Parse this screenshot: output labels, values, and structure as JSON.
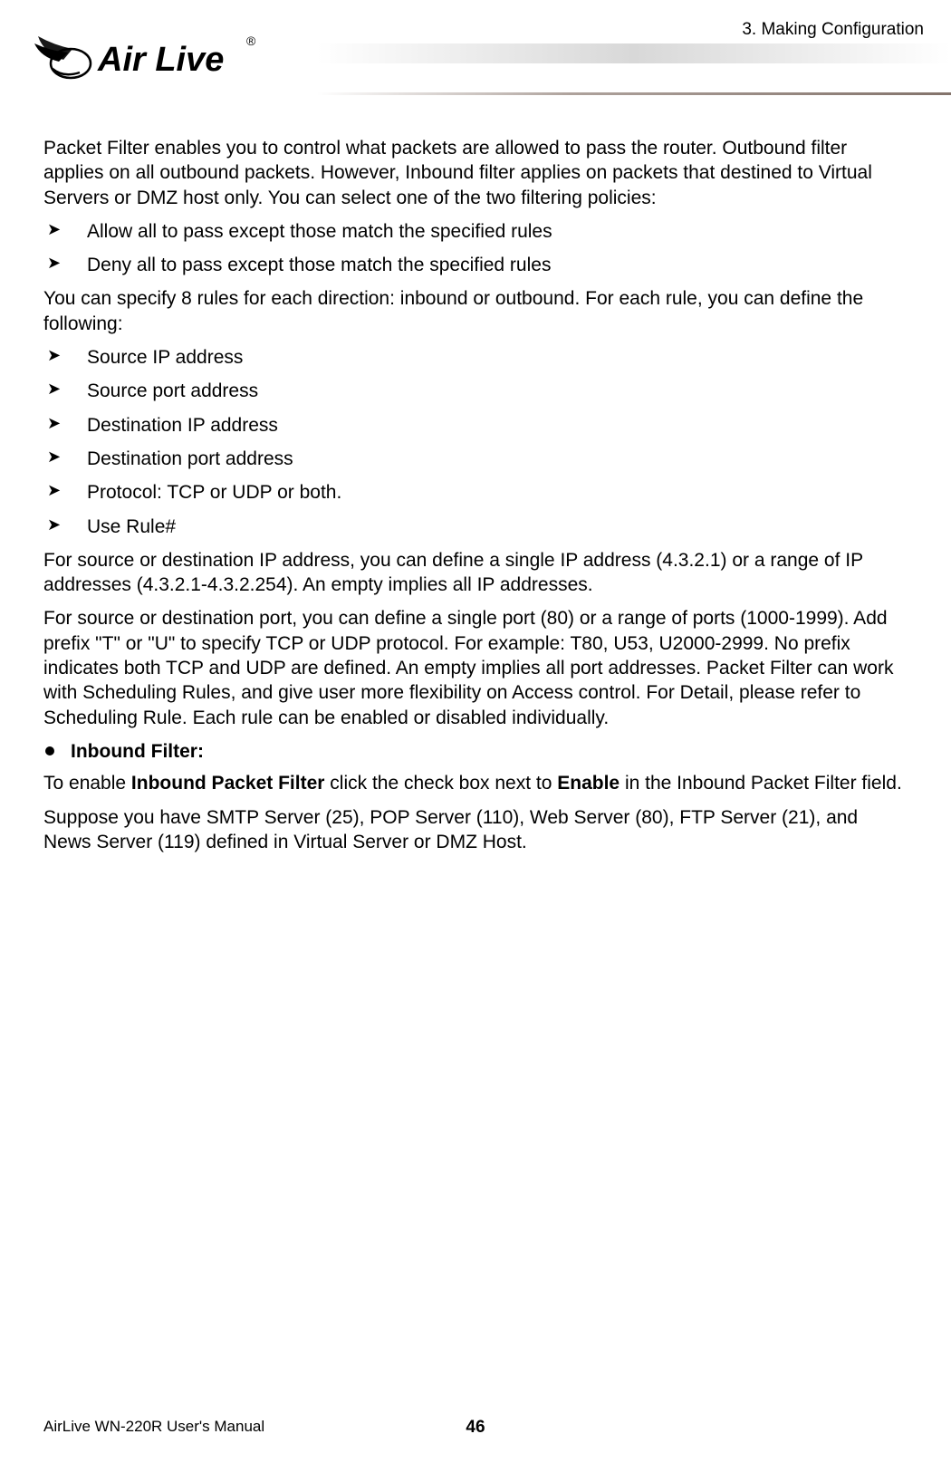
{
  "header": {
    "section_label": "3. Making Configuration",
    "logo_text": "Air Live",
    "trademark": "®"
  },
  "content": {
    "intro_para": "Packet Filter enables you to control what packets are allowed to pass the router. Outbound filter applies on all outbound packets. However, Inbound filter applies on packets that destined to Virtual Servers or DMZ host only. You can select one of the two filtering policies:",
    "policy_list": [
      "Allow all to pass except those match the specified rules",
      "Deny all to pass except those match the specified rules"
    ],
    "rules_para": "You can specify 8 rules for each direction: inbound or outbound. For each rule, you can define the following:",
    "rule_fields": [
      "Source IP address",
      "Source port address",
      "Destination IP address",
      "Destination port address",
      "Protocol: TCP or UDP or both.",
      "Use Rule#"
    ],
    "ip_para": "For source or destination IP address, you can define a single IP address (4.3.2.1) or a range of IP addresses (4.3.2.1-4.3.2.254). An empty implies all IP addresses.",
    "port_para": "For source or destination port, you can define a single port (80) or a range of ports (1000-1999). Add prefix \"T\" or \"U\" to specify TCP or UDP protocol. For example: T80, U53, U2000-2999. No prefix indicates both TCP and UDP are defined. An empty implies all port addresses. Packet Filter can work with Scheduling Rules, and give user more flexibility on Access control. For Detail, please refer to Scheduling Rule. Each rule can be enabled or disabled individually.",
    "inbound_heading": "Inbound Filter:",
    "inbound_para_pre": "To enable ",
    "inbound_para_bold1": "Inbound Packet Filter",
    "inbound_para_mid": " click the check box next to ",
    "inbound_para_bold2": "Enable",
    "inbound_para_post": " in the Inbound Packet Filter field.",
    "server_para": "Suppose you have SMTP Server (25), POP Server (110), Web Server (80), FTP Server (21), and News Server (119) defined in Virtual Server or DMZ Host."
  },
  "footer": {
    "manual_title": "AirLive WN-220R User's Manual",
    "page_number": "46"
  }
}
